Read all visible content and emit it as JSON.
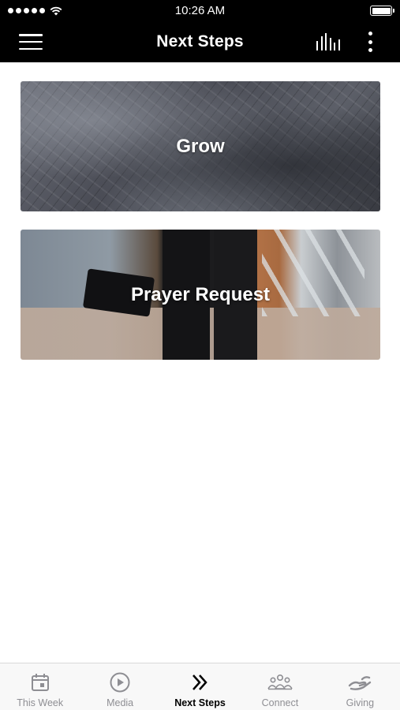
{
  "status_bar": {
    "time": "10:26 AM"
  },
  "header": {
    "title": "Next Steps"
  },
  "cards": [
    {
      "label": "Grow"
    },
    {
      "label": "Prayer Request"
    }
  ],
  "tab_bar": {
    "tabs": [
      {
        "label": "This Week",
        "icon": "calendar-icon",
        "active": false
      },
      {
        "label": "Media",
        "icon": "play-circle-icon",
        "active": false
      },
      {
        "label": "Next Steps",
        "icon": "double-chevron-right-icon",
        "active": true
      },
      {
        "label": "Connect",
        "icon": "people-group-icon",
        "active": false
      },
      {
        "label": "Giving",
        "icon": "giving-hand-icon",
        "active": false
      }
    ]
  },
  "colors": {
    "header_bg": "#000000",
    "tab_inactive": "#8e8e93",
    "tab_active": "#000000"
  }
}
